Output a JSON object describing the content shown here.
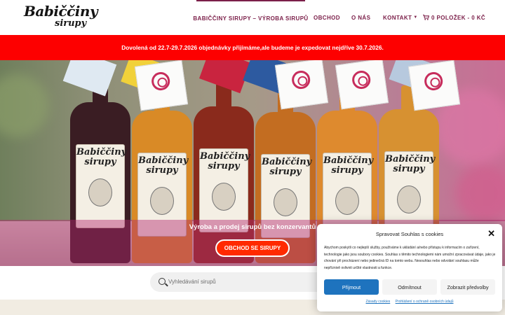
{
  "header": {
    "logo_line1": "Babiččiny",
    "logo_line2": "sirupy",
    "nav": [
      {
        "label": "Babiččiny sirupy – výroba sirupů",
        "active": true
      },
      {
        "label": "Obchod"
      },
      {
        "label": "O nás"
      },
      {
        "label": "Kontakt"
      },
      {
        "label": "0 položek - 0 Kč"
      }
    ]
  },
  "notice": {
    "text": "Dovolená od 22.7-29.7.2026 objednávky přijímáme,ale budeme je expedovat nejdříve 30.7.2026."
  },
  "hero": {
    "caption": "Výroba a prodej sirupů bez konzervantů",
    "button": "Obchod se sirupy",
    "bottle_brand_line1": "Babiččiny",
    "bottle_brand_line2": "sirupy"
  },
  "search": {
    "placeholder": "Vyhledávání sirupů"
  },
  "cookie": {
    "title": "Spravovat Souhlas s cookies",
    "body": "Abychom poskytli co nejlepší služby, používáme k ukládání a/nebo přístupu k informacím o zařízení, technologie jako jsou soubory cookies. Souhlas s těmito technologiemi nám umožní zpracovávat údaje, jako je chování při procházení nebo jedinečná ID na tomto webu. Nesouhlas nebo odvolání souhlasu může nepříznivě ovlivnit určité vlastnosti a funkce.",
    "accept": "Přijmout",
    "deny": "Odmítnout",
    "preferences": "Zobrazit předvolby",
    "link_cookies": "Zásady cookies",
    "link_privacy": "Prohlášení o ochraně osobních údajů"
  },
  "colors": {
    "brand": "#7b1f49",
    "notice_bg": "#fd0000",
    "hero_button": "#ff2a00",
    "cookie_primary": "#1e73be"
  }
}
